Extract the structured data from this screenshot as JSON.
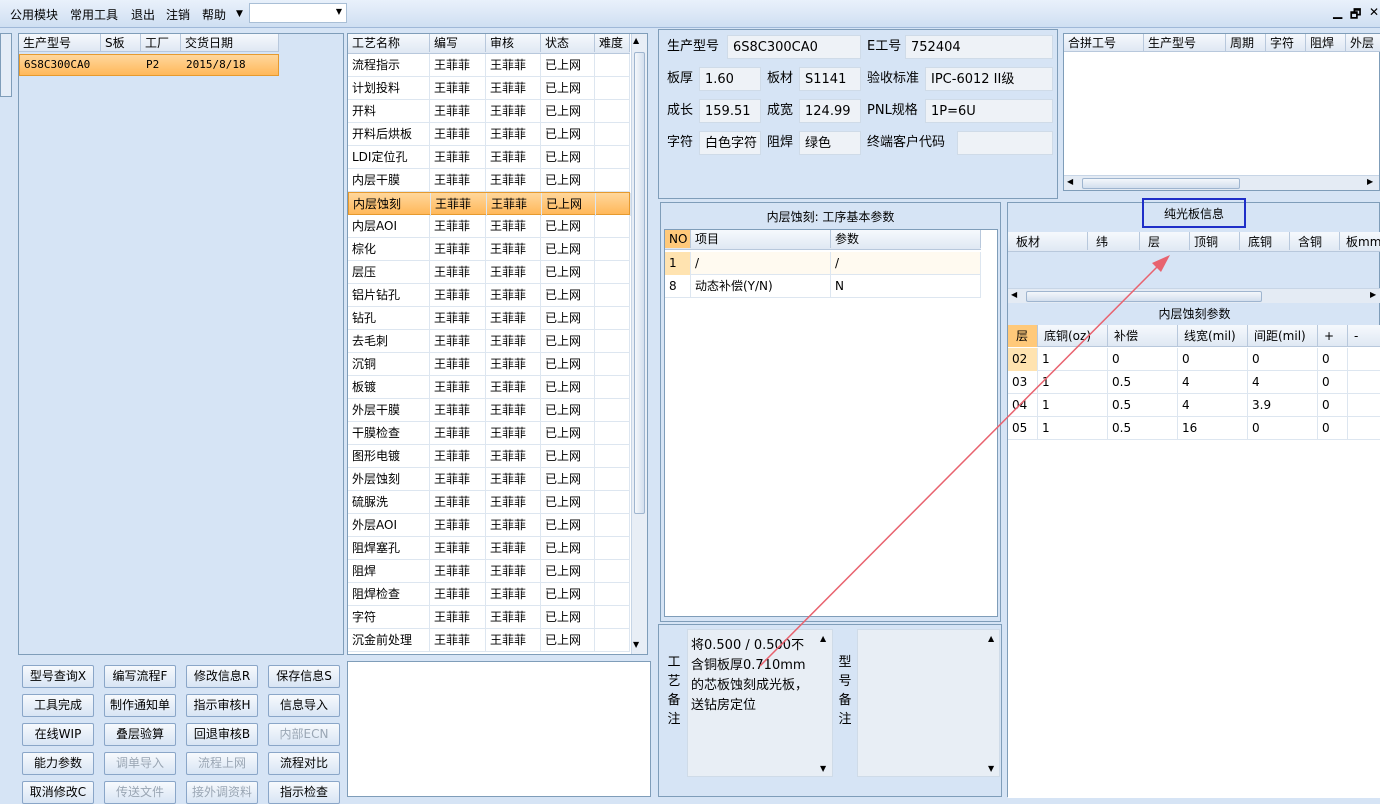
{
  "menu": {
    "items": [
      "公用模块",
      "常用工具",
      "退出",
      "注销",
      "帮助"
    ],
    "restore": "🗗",
    "close": "✕",
    "minimize": "▁"
  },
  "left_grid": {
    "headers": [
      "生产型号",
      "S板",
      "工厂",
      "交货日期"
    ],
    "rows": [
      [
        "6S8C300CA0",
        "",
        "P2",
        "2015/8/18"
      ]
    ]
  },
  "process_grid": {
    "headers": [
      "工艺名称",
      "编写",
      "审核",
      "状态",
      "难度"
    ],
    "rows": [
      [
        "流程指示",
        "王菲菲",
        "王菲菲",
        "已上网"
      ],
      [
        "计划投料",
        "王菲菲",
        "王菲菲",
        "已上网"
      ],
      [
        "开料",
        "王菲菲",
        "王菲菲",
        "已上网"
      ],
      [
        "开料后烘板",
        "王菲菲",
        "王菲菲",
        "已上网"
      ],
      [
        "LDI定位孔",
        "王菲菲",
        "王菲菲",
        "已上网"
      ],
      [
        "内层干膜",
        "王菲菲",
        "王菲菲",
        "已上网"
      ],
      [
        "内层蚀刻",
        "王菲菲",
        "王菲菲",
        "已上网"
      ],
      [
        "内层AOI",
        "王菲菲",
        "王菲菲",
        "已上网"
      ],
      [
        "棕化",
        "王菲菲",
        "王菲菲",
        "已上网"
      ],
      [
        "层压",
        "王菲菲",
        "王菲菲",
        "已上网"
      ],
      [
        "铝片钻孔",
        "王菲菲",
        "王菲菲",
        "已上网"
      ],
      [
        "钻孔",
        "王菲菲",
        "王菲菲",
        "已上网"
      ],
      [
        "去毛刺",
        "王菲菲",
        "王菲菲",
        "已上网"
      ],
      [
        "沉铜",
        "王菲菲",
        "王菲菲",
        "已上网"
      ],
      [
        "板镀",
        "王菲菲",
        "王菲菲",
        "已上网"
      ],
      [
        "外层干膜",
        "王菲菲",
        "王菲菲",
        "已上网"
      ],
      [
        "干膜检查",
        "王菲菲",
        "王菲菲",
        "已上网"
      ],
      [
        "图形电镀",
        "王菲菲",
        "王菲菲",
        "已上网"
      ],
      [
        "外层蚀刻",
        "王菲菲",
        "王菲菲",
        "已上网"
      ],
      [
        "硫脲洗",
        "王菲菲",
        "王菲菲",
        "已上网"
      ],
      [
        "外层AOI",
        "王菲菲",
        "王菲菲",
        "已上网"
      ],
      [
        "阻焊塞孔",
        "王菲菲",
        "王菲菲",
        "已上网"
      ],
      [
        "阻焊",
        "王菲菲",
        "王菲菲",
        "已上网"
      ],
      [
        "阻焊检查",
        "王菲菲",
        "王菲菲",
        "已上网"
      ],
      [
        "字符",
        "王菲菲",
        "王菲菲",
        "已上网"
      ],
      [
        "沉金前处理",
        "王菲菲",
        "王菲菲",
        "已上网"
      ]
    ],
    "selected_index": 6
  },
  "buttons": [
    [
      "型号查询X",
      "编写流程F",
      "修改信息R",
      "保存信息S"
    ],
    [
      "工具完成",
      "制作通知单",
      "指示审核H",
      "信息导入"
    ],
    [
      "在线WIP",
      "叠层验算",
      "回退审核B",
      "内部ECN"
    ],
    [
      "能力参数",
      "调单导入",
      "流程上网",
      "流程对比"
    ],
    [
      "取消修改C",
      "传送文件",
      "接外调资料",
      "指示检查"
    ]
  ],
  "disabled_buttons": [
    "内部ECN",
    "调单导入",
    "流程上网",
    "传送文件",
    "接外调资料"
  ],
  "info": {
    "model_label": "生产型号",
    "model": "6S8C300CA0",
    "ejob_label": "E工号",
    "ejob": "752404",
    "thick_label": "板厚",
    "thick": "1.60",
    "material_label": "板材",
    "material": "S1141",
    "std_label": "验收标准",
    "std": "IPC-6012 II级",
    "len_label": "成长",
    "len": "159.51",
    "wid_label": "成宽",
    "wid": "124.99",
    "pnl_label": "PNL规格",
    "pnl": "1P=6U",
    "char_label": "字符",
    "char": "白色字符",
    "mask_label": "阻焊",
    "mask": "绿色",
    "cust_label": "终端客户代码",
    "cust": ""
  },
  "merge_grid": {
    "headers": [
      "合拼工号",
      "生产型号",
      "周期",
      "字符",
      "阻焊",
      "外层"
    ]
  },
  "params": {
    "title": "内层蚀刻: 工序基本参数",
    "headers": [
      "NO",
      "项目",
      "参数"
    ],
    "rows": [
      [
        "1",
        "/",
        "/"
      ],
      [
        "8",
        "动态补偿(Y/N)",
        "N"
      ]
    ]
  },
  "bare": {
    "title": "纯光板信息",
    "headers": [
      "板材",
      "纬",
      "层",
      "顶铜",
      "底铜",
      "含铜",
      "板mm"
    ]
  },
  "etch": {
    "title": "内层蚀刻参数",
    "headers": [
      "层",
      "底铜(oz)",
      "补偿",
      "线宽(mil)",
      "间距(mil)",
      "+",
      "-"
    ],
    "rows": [
      [
        "02",
        "1",
        "0",
        "0",
        "0",
        "0",
        ""
      ],
      [
        "03",
        "1",
        "0.5",
        "4",
        "4",
        "0",
        ""
      ],
      [
        "04",
        "1",
        "0.5",
        "4",
        "3.9",
        "0",
        ""
      ],
      [
        "05",
        "1",
        "0.5",
        "16",
        "0",
        "0",
        ""
      ]
    ]
  },
  "remark": {
    "label": "工艺备注",
    "text": "将0.500 / 0.500不含铜板厚0.710mm的芯板蚀刻成光板，送钻房定位"
  },
  "model_remark": {
    "label": "型号备注",
    "text": ""
  },
  "colors": {
    "arrow": "#e8636f",
    "highlight_box": "#1f2fc8"
  }
}
